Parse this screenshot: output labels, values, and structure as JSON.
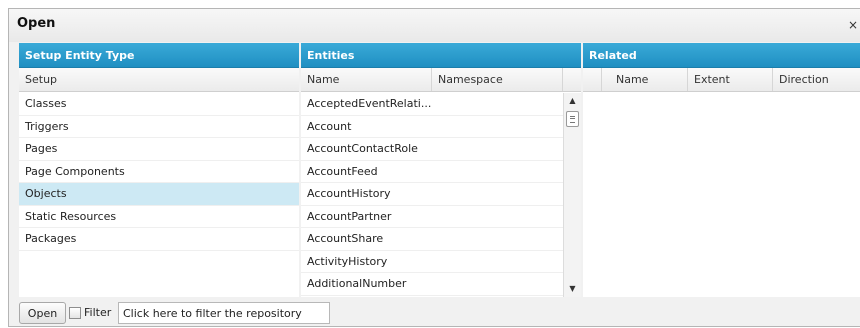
{
  "dialog": {
    "title": "Open",
    "close_symbol": "×"
  },
  "setup_panel": {
    "header": "Setup Entity Type",
    "column": "Setup",
    "items": [
      "Classes",
      "Triggers",
      "Pages",
      "Page Components",
      "Objects",
      "Static Resources",
      "Packages"
    ],
    "selected": "Objects"
  },
  "entities_panel": {
    "header": "Entities",
    "columns": [
      "Name",
      "Namespace"
    ],
    "items": [
      "AcceptedEventRelati...",
      "Account",
      "AccountContactRole",
      "AccountFeed",
      "AccountHistory",
      "AccountPartner",
      "AccountShare",
      "ActivityHistory",
      "AdditionalNumber"
    ]
  },
  "related_panel": {
    "header": "Related",
    "columns": [
      "Name",
      "Extent",
      "Direction"
    ]
  },
  "footer": {
    "open_label": "Open",
    "filter_label": "Filter",
    "filter_value": "Click here to filter the repository"
  },
  "colors": {
    "header_blue": "#2a9fd2",
    "selected_row": "#cde9f4"
  }
}
